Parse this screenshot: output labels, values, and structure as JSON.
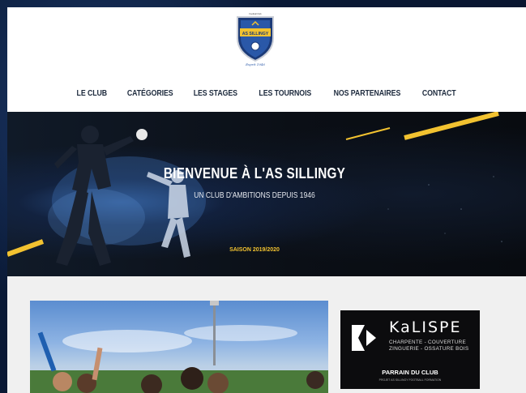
{
  "logo": {
    "name": "AS SILLINGY",
    "motto": "Esprit 1946",
    "small_top": "Football Club"
  },
  "nav": {
    "items": [
      {
        "label": "LE CLUB"
      },
      {
        "label": "CATÉGORIES"
      },
      {
        "label": "LES STAGES"
      },
      {
        "label": "LES TOURNOIS"
      },
      {
        "label": "NOS PARTENAIRES"
      },
      {
        "label": "CONTACT"
      }
    ]
  },
  "hero": {
    "title": "BIENVENUE À L'AS SILLINGY",
    "subtitle": "UN CLUB D'AMBITIONS DEPUIS 1946",
    "season": "SAISON 2019/2020"
  },
  "sponsor": {
    "brand": "KaLISPE",
    "line1": "CHARPENTE - COUVERTURE",
    "line2": "ZINGUERIE - OSSATURE BOIS",
    "label": "PARRAIN DU CLUB",
    "caption": "PROJET AS SILLINGY FOOTBALL FORMATION"
  },
  "carousel": {
    "slide_count": 12,
    "active_index": 2
  },
  "colors": {
    "accent_yellow": "#f2c230",
    "navy": "#0a1a33",
    "nav_text": "#1d2a3d"
  }
}
